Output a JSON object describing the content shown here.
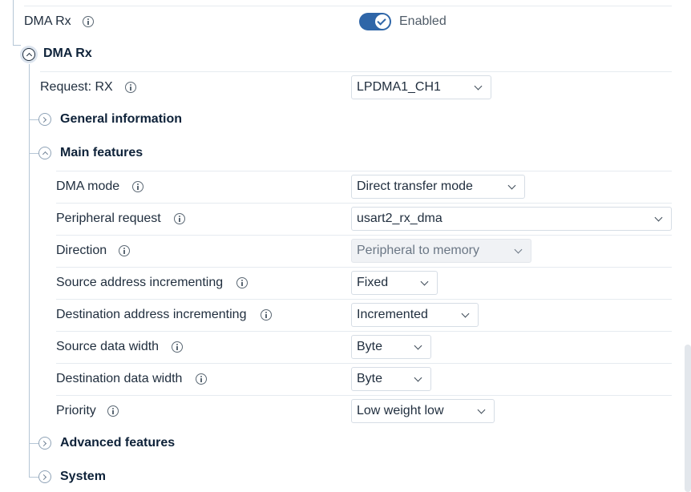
{
  "dma_rx_toggle": {
    "label": "DMA Rx",
    "state_text": "Enabled",
    "checked": true
  },
  "section": {
    "title": "DMA Rx"
  },
  "request": {
    "label": "Request: RX",
    "value": "LPDMA1_CH1"
  },
  "groups": {
    "general": "General information",
    "main": "Main features",
    "advanced": "Advanced features",
    "system": "System"
  },
  "fields": [
    {
      "label": "DMA mode",
      "value": "Direct transfer mode",
      "disabled": false
    },
    {
      "label": "Peripheral request",
      "value": "usart2_rx_dma",
      "disabled": false
    },
    {
      "label": "Direction",
      "value": "Peripheral to memory",
      "disabled": true
    },
    {
      "label": "Source address incrementing",
      "value": "Fixed",
      "disabled": false
    },
    {
      "label": "Destination address incrementing",
      "value": "Incremented",
      "disabled": false
    },
    {
      "label": "Source data width",
      "value": "Byte",
      "disabled": false
    },
    {
      "label": "Destination data width",
      "value": "Byte",
      "disabled": false
    },
    {
      "label": "Priority",
      "value": "Low weight low",
      "disabled": false
    }
  ],
  "colors": {
    "accent": "#2f66a8",
    "tree_line": "#b5c6d6",
    "divider": "#e6ebf0"
  }
}
